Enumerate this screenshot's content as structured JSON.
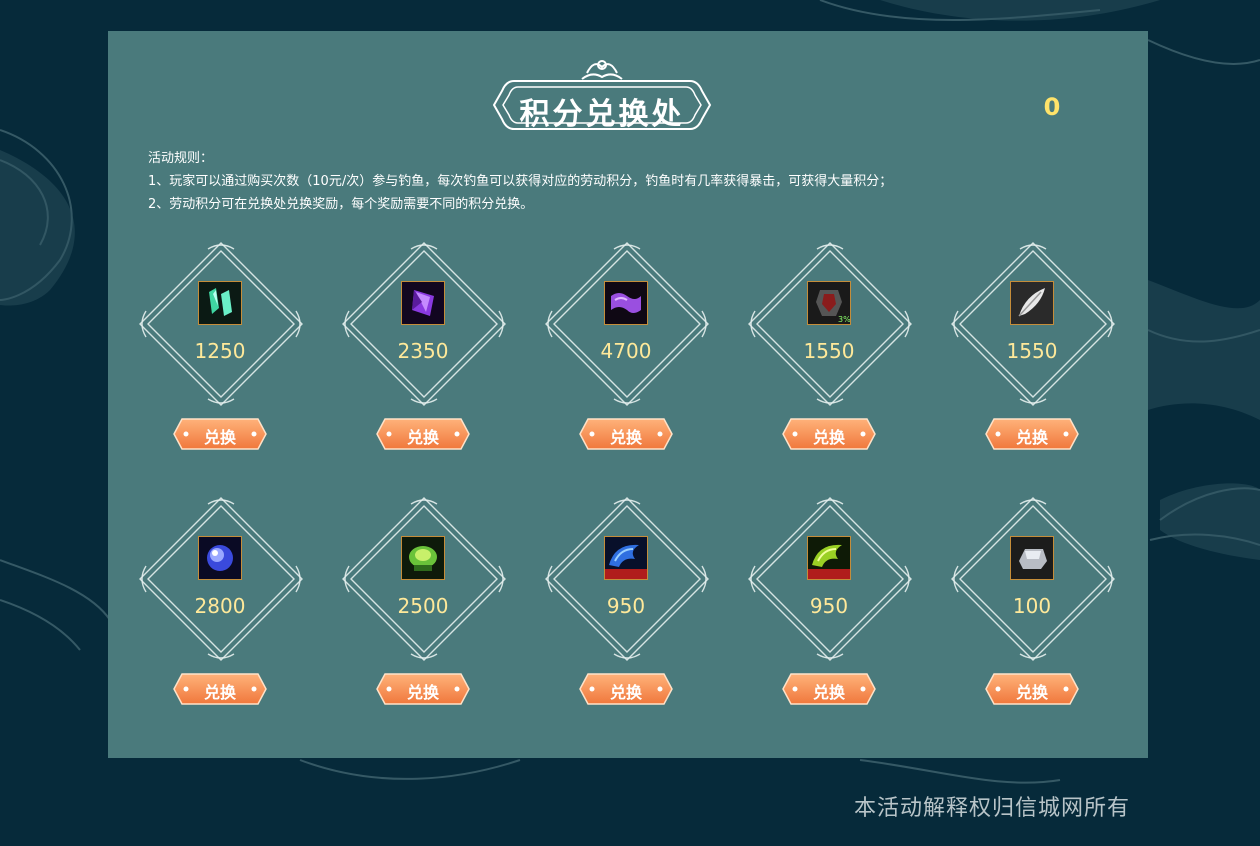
{
  "header": {
    "title": "积分兑换处",
    "points": "0"
  },
  "rules": {
    "heading": "活动规则：",
    "lines": [
      "1、玩家可以通过购买次数（10元/次）参与钓鱼，每次钓鱼可以获得对应的劳动积分，钓鱼时有几率获得暴击，可获得大量积分；",
      "2、劳动积分可在兑换处兑换奖励，每个奖励需要不同的积分兑换。"
    ]
  },
  "exchange_label": "兑换",
  "items": [
    {
      "icon": "green-crystal-icon",
      "cost": "1250"
    },
    {
      "icon": "purple-gem-icon",
      "cost": "2350"
    },
    {
      "icon": "purple-scroll-icon",
      "cost": "4700"
    },
    {
      "icon": "dark-armor-icon",
      "cost": "1550",
      "badge": "3%"
    },
    {
      "icon": "white-feather-icon",
      "cost": "1550"
    },
    {
      "icon": "blue-orb-icon",
      "cost": "2800"
    },
    {
      "icon": "green-beast-icon",
      "cost": "2500"
    },
    {
      "icon": "blue-wing-icon",
      "cost": "950"
    },
    {
      "icon": "green-wing-icon",
      "cost": "950"
    },
    {
      "icon": "silver-ingot-icon",
      "cost": "100"
    }
  ],
  "footer": "本活动解释权归信城网所有"
}
